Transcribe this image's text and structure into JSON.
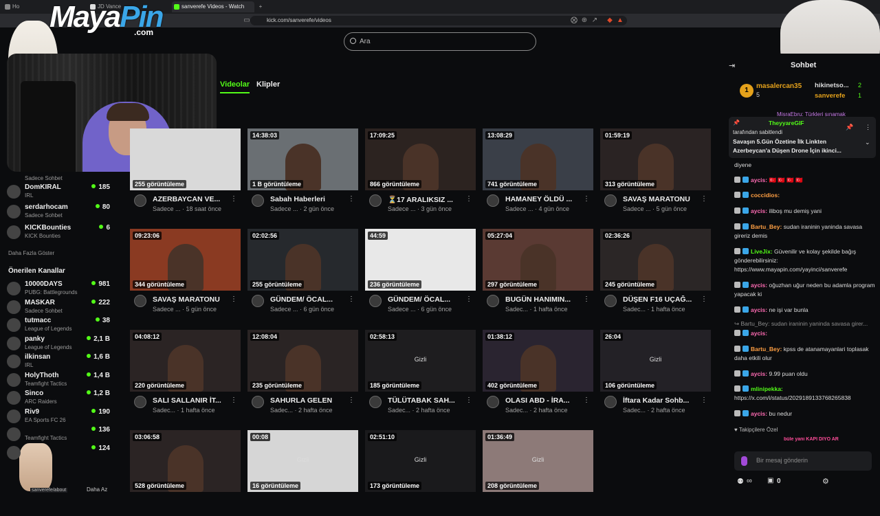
{
  "browser": {
    "tabs": [
      {
        "label": "Ho"
      },
      {
        "label": "JD Vance"
      },
      {
        "label": "sanverefe Videos - Watch On-De"
      }
    ],
    "new_tab": "+",
    "url": "kick.com/sanverefe/videos",
    "status_url": "sanverefe/about"
  },
  "overlay": {
    "logo_main": "Maya",
    "logo_pin": "Pin",
    "logo_com": ".com"
  },
  "search": {
    "placeholder": "Ara"
  },
  "tabs": {
    "videos": "Videolar",
    "clips": "Klipler"
  },
  "sidebar": {
    "top_sub": "Sadece Sohbet",
    "followed": [
      {
        "name": "DomKIRAL",
        "category": "IRL",
        "viewers": "185"
      },
      {
        "name": "serdarhocam",
        "category": "Sadece Sohbet",
        "viewers": "80"
      },
      {
        "name": "KICKBounties",
        "category": "KICK Bounties",
        "viewers": "6"
      }
    ],
    "show_more": "Daha Fazla Göster",
    "recommended_title": "Önerilen Kanallar",
    "recommended": [
      {
        "name": "10000DAYS",
        "category": "PUBG: Battlegrounds",
        "viewers": "981"
      },
      {
        "name": "MASKAR",
        "category": "Sadece Sohbet",
        "viewers": "222"
      },
      {
        "name": "tutmacc",
        "category": "League of Legends",
        "viewers": "38"
      },
      {
        "name": "panky",
        "category": "League of Legends",
        "viewers": "2,1 B"
      },
      {
        "name": "ilkinsan",
        "category": "IRL",
        "viewers": "1,6 B"
      },
      {
        "name": "HolyThoth",
        "category": "Teamfight Tactics",
        "viewers": "1,4 B"
      },
      {
        "name": "Sinco",
        "category": "ARC Raiders",
        "viewers": "1,2 B"
      },
      {
        "name": "Riv9",
        "category": "EA Sports FC 26",
        "viewers": "190"
      },
      {
        "name": "",
        "category": "Teamfight Tactics",
        "viewers": "136"
      },
      {
        "name": "",
        "category": "",
        "viewers": "124"
      }
    ],
    "show_less": "Daha Az"
  },
  "videos": [
    {
      "duration": "",
      "views": "255 görüntüleme",
      "title": "AZERBAYCAN VE...",
      "sub": "Sadece ... · 18 saat önce",
      "bg": "#d9d9d9",
      "private": ""
    },
    {
      "duration": "14:38:03",
      "views": "1 B görüntüleme",
      "title": "Sabah Haberleri",
      "sub": "Sadece ... · 2 gün önce",
      "bg": "#6a6f73",
      "private": ""
    },
    {
      "duration": "17:09:25",
      "views": "866 görüntüleme",
      "title": "⏳17 ARALIKSIZ ...",
      "sub": "Sadece ... · 3 gün önce",
      "bg": "#2c2320",
      "private": ""
    },
    {
      "duration": "13:08:29",
      "views": "741 görüntüleme",
      "title": "HAMANEY ÖLDÜ ...",
      "sub": "Sadece ... · 4 gün önce",
      "bg": "#3a3f48",
      "private": ""
    },
    {
      "duration": "01:59:19",
      "views": "313 görüntüleme",
      "title": "SAVAŞ MARATONU",
      "sub": "Sadece ... · 5 gün önce",
      "bg": "#2a2323",
      "private": ""
    },
    {
      "duration": "09:23:06",
      "views": "344 görüntüleme",
      "title": "SAVAŞ MARATONU",
      "sub": "Sadece ... · 5 gün önce",
      "bg": "#8a3a22",
      "private": ""
    },
    {
      "duration": "02:02:56",
      "views": "255 görüntüleme",
      "title": "GÜNDEM/ ÖCAL...",
      "sub": "Sadece ... · 6 gün önce",
      "bg": "#26292d",
      "private": ""
    },
    {
      "duration": "44:59",
      "views": "236 görüntüleme",
      "title": "GÜNDEM/ ÖCAL...",
      "sub": "Sadece ... · 6 gün önce",
      "bg": "#e8e8e8",
      "private": ""
    },
    {
      "duration": "05:27:04",
      "views": "297 görüntüleme",
      "title": "BUGÜN HANIMIN...",
      "sub": "Sadec... · 1 hafta önce",
      "bg": "#5a3a33",
      "private": ""
    },
    {
      "duration": "02:36:26",
      "views": "245 görüntüleme",
      "title": "DÜŞEN F16 UÇAĞ...",
      "sub": "Sadec... · 1 hafta önce",
      "bg": "#2b2626",
      "private": ""
    },
    {
      "duration": "04:08:12",
      "views": "220 görüntüleme",
      "title": "SALI SALLANIR İT...",
      "sub": "Sadec... · 1 hafta önce",
      "bg": "#2b2424",
      "private": ""
    },
    {
      "duration": "12:08:04",
      "views": "235 görüntüleme",
      "title": "SAHURLA GELEN",
      "sub": "Sadec... · 2 hafta önce",
      "bg": "#2a2424",
      "private": ""
    },
    {
      "duration": "02:58:13",
      "views": "185 görüntüleme",
      "title": "TÜLÜTABAK SAH...",
      "sub": "Sadec... · 2 hafta önce",
      "bg": "#1e1d1f",
      "private": "Gizli"
    },
    {
      "duration": "01:38:12",
      "views": "402 görüntüleme",
      "title": "OLASI ABD - İRA...",
      "sub": "Sadec... · 2 hafta önce",
      "bg": "#2a2430",
      "private": ""
    },
    {
      "duration": "26:04",
      "views": "106 görüntüleme",
      "title": "İftara Kadar Sohb...",
      "sub": "Sadec... · 2 hafta önce",
      "bg": "#232126",
      "private": "Gizli"
    },
    {
      "duration": "03:06:58",
      "views": "528 görüntüleme",
      "title": "",
      "sub": "",
      "bg": "#2b2424",
      "private": ""
    },
    {
      "duration": "00:08",
      "views": "16 görüntüleme",
      "title": "",
      "sub": "",
      "bg": "#d6d6d6",
      "private": "Gizli"
    },
    {
      "duration": "02:51:10",
      "views": "173 görüntüleme",
      "title": "",
      "sub": "",
      "bg": "#1a1a1c",
      "private": "Gizli"
    },
    {
      "duration": "01:36:49",
      "views": "208 görüntüleme",
      "title": "",
      "sub": "",
      "bg": "#8d7a78",
      "private": "Gizli"
    }
  ],
  "chat": {
    "title": "Sohbet",
    "gifters": [
      {
        "rank": "1",
        "name": "masalercan35",
        "count": "5"
      },
      {
        "name": "hikinetso...",
        "count": "2"
      },
      {
        "name": "sanverefe",
        "count": "1"
      }
    ],
    "top_cut": "MisraEbru: Türkleri sınamak",
    "pinned_user": "TheyyareGIF",
    "pinned_by": "tarafından sabitlendi",
    "pinned_text": "Savaşın 5.Gün Özetine İlk Linkten Azerbeycan'a Düşen Drone İçin ikinci...",
    "messages": [
      {
        "user": "",
        "text": "diyene",
        "color": "#ddd"
      },
      {
        "user": "aycis:",
        "text": "🇹🇷 🇹🇷 🇹🇷 🇹🇷",
        "color": "#ff6bb3"
      },
      {
        "user": "coccidios:",
        "text": "",
        "color": "#ff9f43"
      },
      {
        "user": "aycis:",
        "text": "iliboş mu demiş yani",
        "color": "#ff6bb3"
      },
      {
        "user": "Bartu_Bey:",
        "text": "sudan iraninin yaninda savasa gireriz demis",
        "color": "#ff9f43"
      },
      {
        "user": "LiveJix:",
        "text": "Güvenilir ve kolay şekilde bağış gönderebilirsiniz: https://www.mayapin.com/yayinci/sanverefe",
        "color": "#53fc18"
      },
      {
        "user": "aycis:",
        "text": "oğuzhan uğur neden bu adamla program yapacak ki",
        "color": "#ff6bb3"
      },
      {
        "user": "aycis:",
        "text": "ne işi var bunla",
        "color": "#ff6bb3"
      },
      {
        "user": "",
        "text": "↪ Bartu_Bey: sudan iraninin yaninda savasa girer...",
        "color": "#8d8d8d"
      },
      {
        "user": "aycis:",
        "text": "",
        "color": "#ff6bb3"
      },
      {
        "user": "Bartu_Bey:",
        "text": "kpss de atanamayanlari toplasak daha etkili olur",
        "color": "#ff9f43"
      },
      {
        "user": "aycis:",
        "text": "9.99 puan oldu",
        "color": "#ff6bb3"
      },
      {
        "user": "mlinipekka:",
        "text": "https://x.com/i/status/2029189133768265838",
        "color": "#53fc18"
      },
      {
        "user": "aycis:",
        "text": "bu nedur",
        "color": "#ff6bb3"
      }
    ],
    "followers_only": "Takipçilere Özel",
    "emote_text": "bûle yani KAPI DIYO ARKA ÇIKIN",
    "input_placeholder": "Bir mesaj gönderin",
    "infinity": "∞",
    "points": "0"
  },
  "colors": {
    "accent": "#53fc18",
    "bg": "#0b0c0e",
    "logo_blue": "#3aa6e8"
  }
}
